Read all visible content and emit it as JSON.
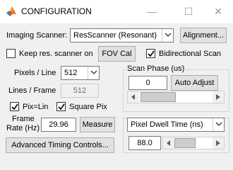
{
  "window": {
    "title": "CONFIGURATION",
    "min_glyph": "—",
    "max_glyph": "☐",
    "close_glyph": "✕"
  },
  "scanner": {
    "label": "Imaging Scanner:",
    "selected": "ResScanner (Resonant)",
    "alignment_button": "Alignment...",
    "keep_res_label": "Keep res. scanner on",
    "keep_res_checked": false,
    "fov_cal_button": "FOV Cal",
    "bidirectional_label": "Bidirectional Scan",
    "bidirectional_checked": true
  },
  "geometry": {
    "pixels_per_line_label": "Pixels / Line",
    "pixels_per_line_value": "512",
    "lines_per_frame_label": "Lines / Frame",
    "lines_per_frame_value": "512",
    "pix_eq_lin_label": "Pix=Lin",
    "pix_eq_lin_checked": true,
    "square_pix_label": "Square Pix",
    "square_pix_checked": true,
    "frame_rate_label_line1": "Frame",
    "frame_rate_label_line2": "Rate (Hz)",
    "frame_rate_value": "29.96",
    "measure_button": "Measure",
    "advanced_button": "Advanced Timing Controls..."
  },
  "scan_phase": {
    "group_label": "Scan Phase (us)",
    "value": "0",
    "auto_adjust_button": "Auto Adjust"
  },
  "dwell": {
    "selected": "Pixel Dwell Time (ns)",
    "value": "88.0"
  }
}
